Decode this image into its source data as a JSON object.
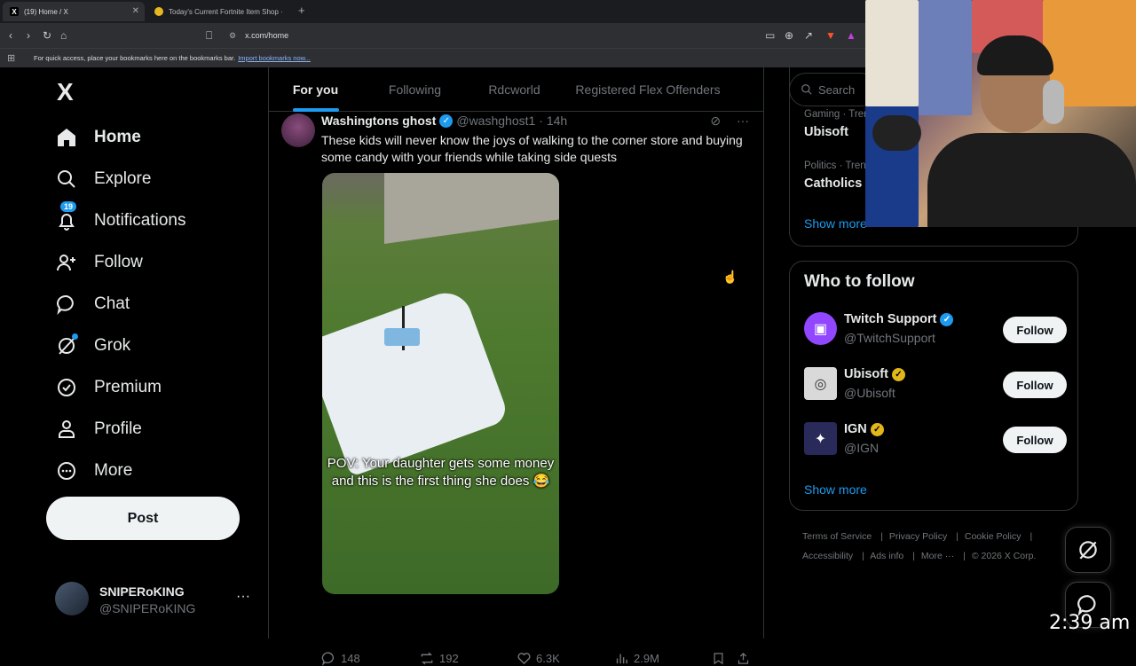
{
  "browser": {
    "tabs": [
      {
        "label": "(19) Home / X",
        "favicon": "X",
        "active": true
      },
      {
        "label": "Today's Current Fortnite Item Shop ·",
        "favicon": "●",
        "active": false
      }
    ],
    "new_tab": "+",
    "url": "x.com/home",
    "bookmarks_hint": "For quick access, place your bookmarks here on the bookmarks bar.",
    "bookmarks_link": "Import bookmarks now..."
  },
  "nav": {
    "logo": "X",
    "items": [
      {
        "label": "Home",
        "icon": "home-icon"
      },
      {
        "label": "Explore",
        "icon": "search-icon"
      },
      {
        "label": "Notifications",
        "icon": "bell-icon",
        "badge": "19"
      },
      {
        "label": "Follow",
        "icon": "add-person-icon"
      },
      {
        "label": "Chat",
        "icon": "chat-icon"
      },
      {
        "label": "Grok",
        "icon": "grok-icon"
      },
      {
        "label": "Premium",
        "icon": "verified-icon"
      },
      {
        "label": "Profile",
        "icon": "person-icon"
      },
      {
        "label": "More",
        "icon": "more-circle-icon"
      }
    ],
    "post_label": "Post",
    "account": {
      "name": "SNIPERoKING",
      "handle": "@SNIPERoKING",
      "more": "···"
    }
  },
  "feed": {
    "tabs": [
      "For you",
      "Following",
      "Rdcworld",
      "Registered Flex Offenders"
    ],
    "tweet": {
      "name": "Washingtons ghost",
      "handle": "@washghost1",
      "time": "· 14h",
      "text": "These kids will never know the joys of walking to the corner store and buying some candy with your friends while taking side quests",
      "caption": "POV: Your daughter gets some money and this is the first thing she does 😂",
      "replies": "148",
      "reposts": "192",
      "likes": "6.3K",
      "views": "2.9M"
    }
  },
  "right": {
    "search_placeholder": "Search",
    "trends": [
      {
        "category": "Gaming · Tren",
        "name": "Ubisoft"
      },
      {
        "category": "Politics · Tren",
        "name": "Catholics"
      }
    ],
    "trends_show_more": "Show more",
    "who_to_follow_title": "Who to follow",
    "suggestions": [
      {
        "name": "Twitch Support",
        "handle": "@TwitchSupport",
        "verified": "blue",
        "color": "#9146ff"
      },
      {
        "name": "Ubisoft",
        "handle": "@Ubisoft",
        "verified": "gold",
        "color": "#d9d9d9"
      },
      {
        "name": "IGN",
        "handle": "@IGN",
        "verified": "gold",
        "color": "#2a2a5a"
      }
    ],
    "follow_label": "Follow",
    "wtf_show_more": "Show more",
    "footer": [
      "Terms of Service",
      "Privacy Policy",
      "Cookie Policy",
      "Accessibility",
      "Ads info",
      "More ···",
      "© 2026 X Corp."
    ]
  },
  "overlay": {
    "clock": "2:39 am"
  },
  "colors": {
    "accent": "#1d9bf0",
    "background": "#000000",
    "border": "#2f3336"
  }
}
